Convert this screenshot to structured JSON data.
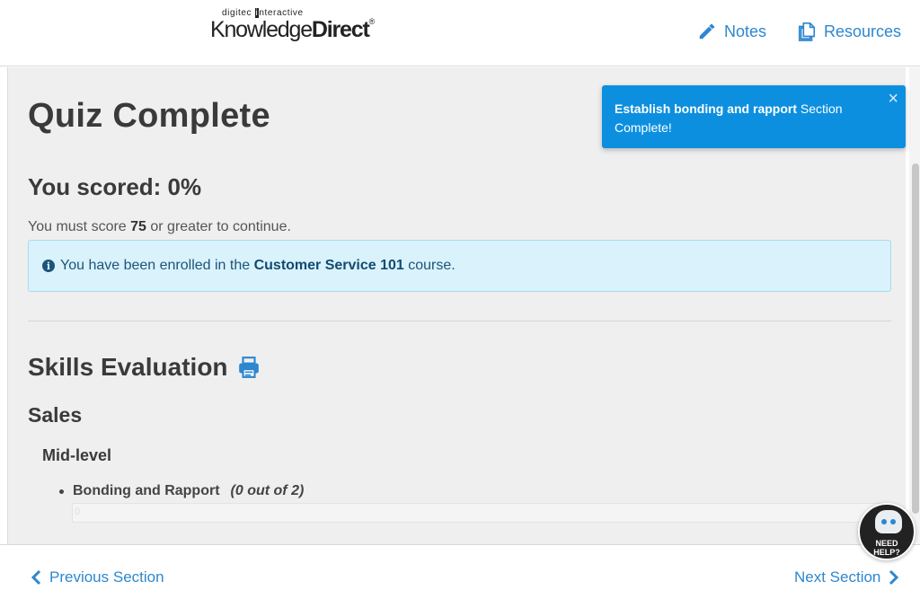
{
  "header": {
    "logo_small_first": "digitec",
    "logo_small_box": "i",
    "logo_small_rest": "nteractive",
    "logo_big_light": "Knowledge",
    "logo_big_bold": "Direct",
    "logo_reg": "®",
    "notes_label": "Notes",
    "resources_label": "Resources"
  },
  "main": {
    "title": "Quiz Complete",
    "score_heading": "You scored: 0%",
    "must_score_prefix": "You must score ",
    "must_score_value": "75",
    "must_score_suffix": " or greater to continue.",
    "info_icon": "i",
    "info_prefix": "You have been enrolled in the ",
    "info_course": "Customer Service 101",
    "info_suffix": " course."
  },
  "skills": {
    "title": "Skills Evaluation",
    "category": "Sales",
    "level": "Mid-level",
    "item_name": "Bonding and Rapport",
    "item_count": "(0 out of 2)",
    "progress_label": "0",
    "progress_fraction": 0
  },
  "toast": {
    "bold": "Establish bonding and rapport",
    "rest": " Section Complete!",
    "close": "×"
  },
  "footer": {
    "prev_label": "Previous Section",
    "next_label": "Next Section"
  },
  "help": {
    "line1": "NEED",
    "line2": "HELP?"
  },
  "colors": {
    "accent": "#2d87cf",
    "toast_bg": "#0d8fe0",
    "info_bg": "#d9f2fc",
    "content_bg": "#efefef"
  },
  "icons": [
    "pencil-icon",
    "documents-icon",
    "printer-icon",
    "info-circle-icon",
    "close-icon",
    "chevron-left-icon",
    "chevron-right-icon",
    "robot-icon"
  ]
}
